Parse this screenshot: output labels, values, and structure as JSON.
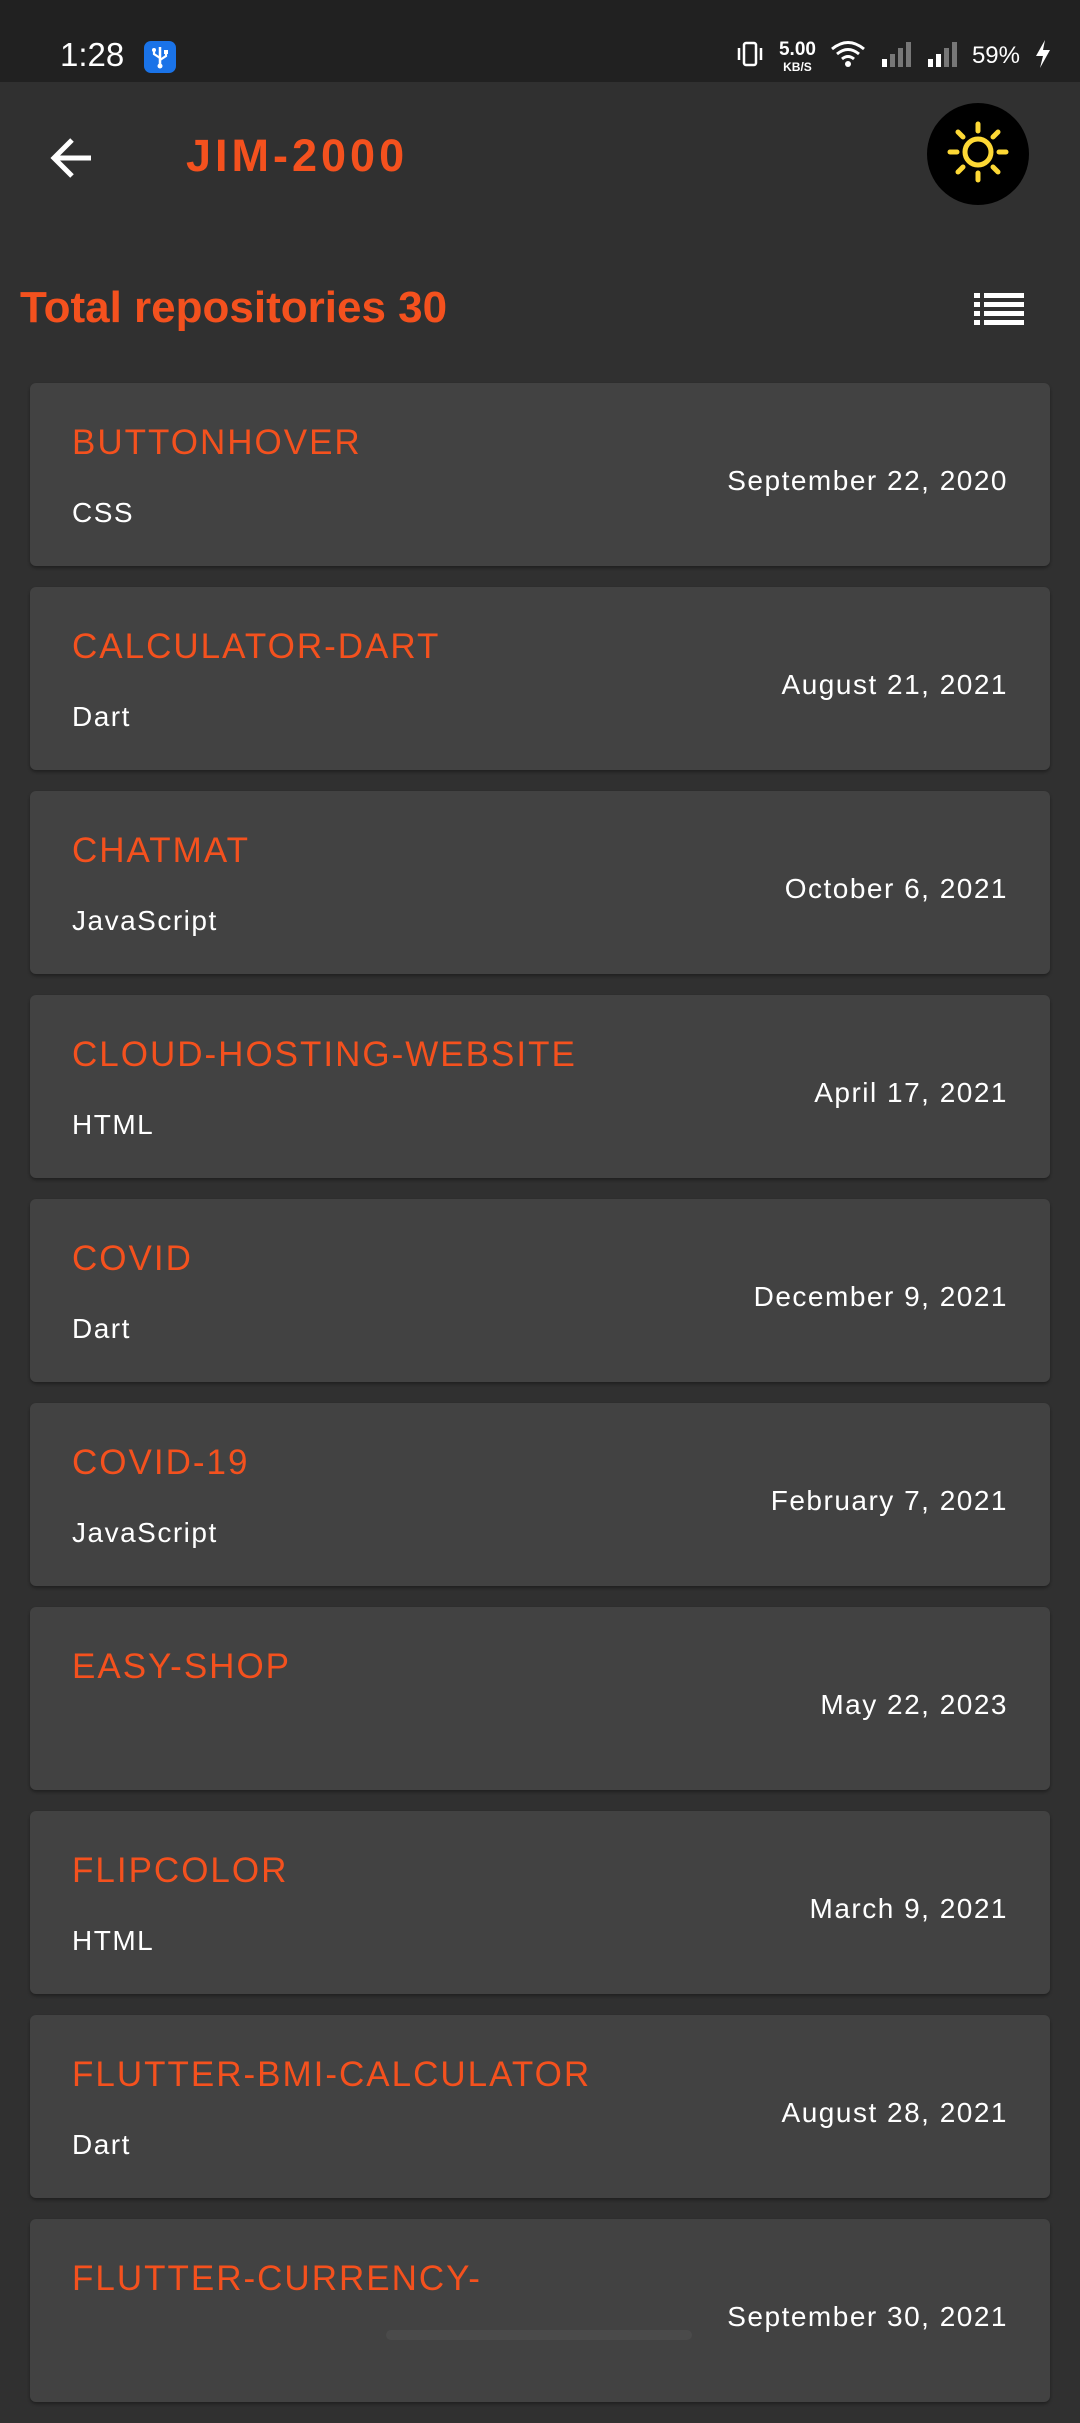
{
  "status_bar": {
    "time": "1:28",
    "net_speed_value": "5.00",
    "net_speed_unit": "KB/S",
    "battery": "59%",
    "icons": [
      "usb-debug-icon",
      "vibrate-icon",
      "wifi-icon",
      "signal-icon",
      "signal-icon",
      "charging-icon"
    ]
  },
  "app_bar": {
    "title": "JIM-2000",
    "back_icon": "arrow-back-icon",
    "theme_icon": "sun-icon"
  },
  "summary": {
    "total_label": "Total repositories 30",
    "view_toggle_icon": "list-icon"
  },
  "colors": {
    "accent": "#f4511e",
    "background": "#303030",
    "card": "#424242",
    "status_bar": "#212121",
    "sun": "#fdd835"
  },
  "repos": [
    {
      "name": "BUTTONHOVER",
      "language": "CSS",
      "date": "September 22, 2020"
    },
    {
      "name": "CALCULATOR-DART",
      "language": "Dart",
      "date": "August 21, 2021"
    },
    {
      "name": "CHATMAT",
      "language": "JavaScript",
      "date": "October 6, 2021"
    },
    {
      "name": "CLOUD-HOSTING-WEBSITE",
      "language": "HTML",
      "date": "April 17, 2021"
    },
    {
      "name": "COVID",
      "language": "Dart",
      "date": "December 9, 2021"
    },
    {
      "name": "COVID-19",
      "language": "JavaScript",
      "date": "February 7, 2021"
    },
    {
      "name": "EASY-SHOP",
      "language": "",
      "date": "May 22, 2023"
    },
    {
      "name": "FLIPCOLOR",
      "language": "HTML",
      "date": "March 9, 2021"
    },
    {
      "name": "FLUTTER-BMI-CALCULATOR",
      "language": "Dart",
      "date": "August 28, 2021"
    },
    {
      "name": "FLUTTER-CURRENCY-",
      "language": "",
      "date": "September 30, 2021"
    }
  ]
}
